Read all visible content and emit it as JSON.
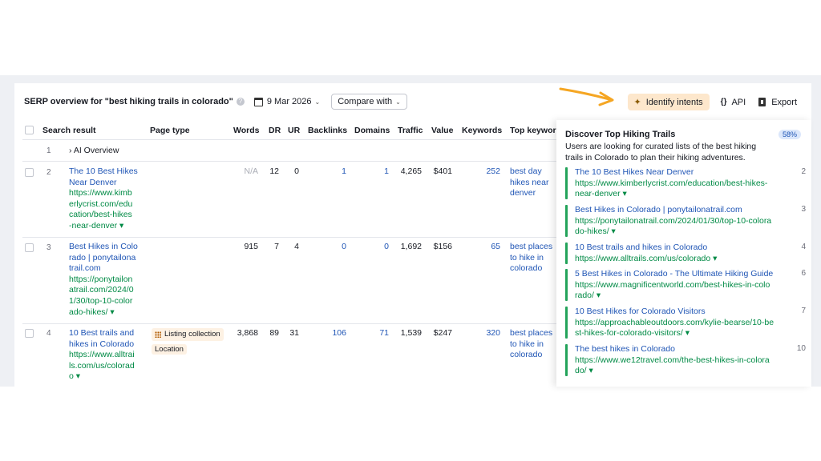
{
  "header": {
    "title": "SERP overview for \"best hiking trails in colorado\"",
    "date": "9 Mar 2026",
    "compare_label": "Compare with",
    "identify_intents_label": "Identify intents",
    "api_label": "API",
    "export_label": "Export"
  },
  "table": {
    "columns": [
      "Search result",
      "Page type",
      "Words",
      "DR",
      "UR",
      "Backlinks",
      "Domains",
      "Traffic",
      "Value",
      "Keywords",
      "Top keyword"
    ],
    "ai_overview": {
      "num": "1",
      "label": "› AI Overview"
    },
    "rows": [
      {
        "num": "2",
        "title_lines": [
          "The 10 Best Hikes",
          "Near Denver"
        ],
        "url_lines": [
          "https://www.kimb",
          "erlycrist.com/edu",
          "cation/best-hikes",
          "-near-denver ▾"
        ],
        "page_type": "",
        "words": "N/A",
        "dr": "12",
        "ur": "0",
        "backlinks": "1",
        "domains": "1",
        "traffic": "4,265",
        "value": "$401",
        "keywords": "252",
        "top_keyword_lines": [
          "best day",
          "hikes near",
          "denver"
        ]
      },
      {
        "num": "3",
        "title_lines": [
          "Best Hikes in Colo",
          "rado | ponytailona",
          "trail.com"
        ],
        "url_lines": [
          "https://ponytailon",
          "atrail.com/2024/0",
          "1/30/top-10-color",
          "ado-hikes/ ▾"
        ],
        "page_type": "",
        "words": "915",
        "dr": "7",
        "ur": "4",
        "backlinks": "0",
        "domains": "0",
        "traffic": "1,692",
        "value": "$156",
        "keywords": "65",
        "top_keyword_lines": [
          "best places",
          "to hike in",
          "colorado"
        ]
      },
      {
        "num": "4",
        "title_lines": [
          "10 Best trails and",
          "hikes in Colorado"
        ],
        "url_lines": [
          "https://www.alltrai",
          "ls.com/us/colorad",
          "o ▾"
        ],
        "page_type": "Listing collection",
        "page_type_2": "Location",
        "words": "3,868",
        "dr": "89",
        "ur": "31",
        "backlinks": "106",
        "domains": "71",
        "traffic": "1,539",
        "value": "$247",
        "keywords": "320",
        "top_keyword_lines": [
          "best places",
          "to hike in",
          "colorado"
        ]
      }
    ]
  },
  "intents_panel": {
    "title": "Discover Top Hiking Trails",
    "percent": "58%",
    "description_lines": [
      "Users are looking for curated lists of the best hiking",
      "trails in Colorado to plan their hiking adventures."
    ],
    "results": [
      {
        "title": "The 10 Best Hikes Near Denver",
        "url_lines": [
          "https://www.kimberlycrist.com/education/best-hikes-",
          "near-denver ▾"
        ],
        "rank": "2"
      },
      {
        "title": "Best Hikes in Colorado | ponytailonatrail.com",
        "url_lines": [
          "https://ponytailonatrail.com/2024/01/30/top-10-colora",
          "do-hikes/ ▾"
        ],
        "rank": "3"
      },
      {
        "title": "10 Best trails and hikes in Colorado",
        "url_lines": [
          "https://www.alltrails.com/us/colorado ▾"
        ],
        "rank": "4"
      },
      {
        "title": "5 Best Hikes in Colorado - The Ultimate Hiking Guide",
        "url_lines": [
          "https://www.magnificentworld.com/best-hikes-in-colo",
          "rado/ ▾"
        ],
        "rank": "6"
      },
      {
        "title": "10 Best Hikes for Colorado Visitors",
        "url_lines": [
          "https://approachableoutdoors.com/kylie-bearse/10-be",
          "st-hikes-for-colorado-visitors/ ▾"
        ],
        "rank": "7"
      },
      {
        "title": "The best hikes in Colorado",
        "url_lines": [
          "https://www.we12travel.com/the-best-hikes-in-colora",
          "do/ ▾"
        ],
        "rank": "10"
      }
    ]
  },
  "colors": {
    "accent_orange": "#f5a623",
    "link_blue": "#1f55b5",
    "url_green": "#008a45",
    "intent_bar": "#23a35a"
  }
}
